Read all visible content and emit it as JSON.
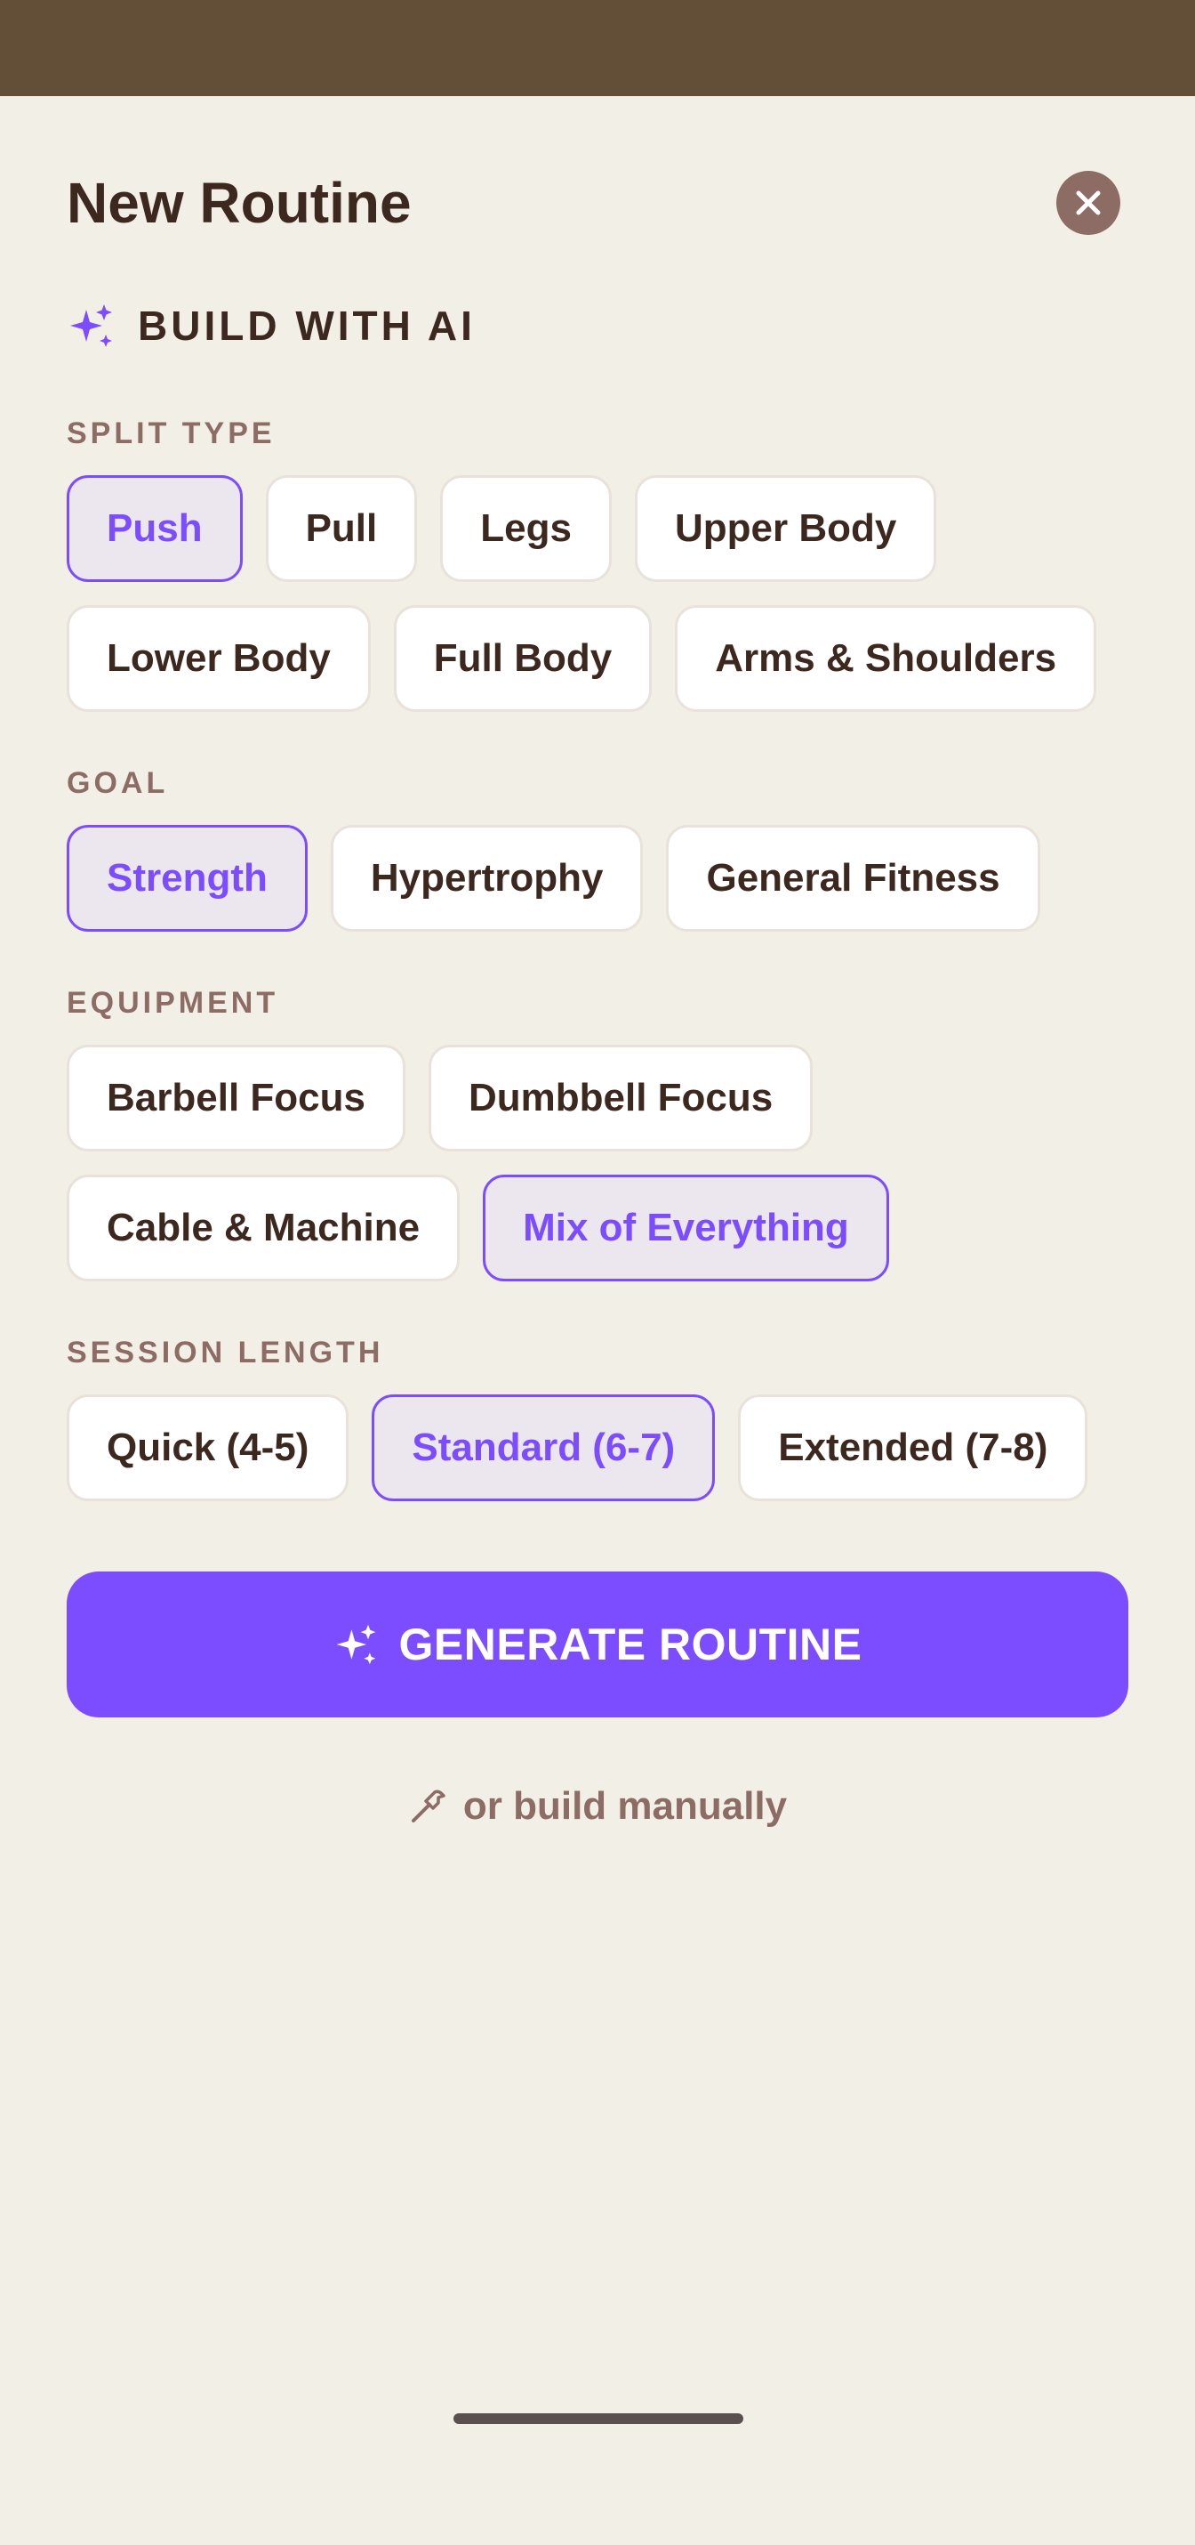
{
  "colors": {
    "accent": "#7c4dff",
    "accent_soft": "#ece6ee",
    "text_primary": "#3d2820",
    "text_muted": "#8c6c64",
    "background": "#f2efe6",
    "backdrop": "#634e37"
  },
  "sheet": {
    "title": "New Routine",
    "close_icon": "close-icon"
  },
  "ai_section": {
    "icon": "sparkles-icon",
    "label": "BUILD WITH AI"
  },
  "split_type": {
    "label": "SPLIT TYPE",
    "options": [
      "Push",
      "Pull",
      "Legs",
      "Upper Body",
      "Lower Body",
      "Full Body",
      "Arms & Shoulders"
    ],
    "selected": "Push"
  },
  "goal": {
    "label": "GOAL",
    "options": [
      "Strength",
      "Hypertrophy",
      "General Fitness"
    ],
    "selected": "Strength"
  },
  "equipment": {
    "label": "EQUIPMENT",
    "options": [
      "Barbell Focus",
      "Dumbbell Focus",
      "Cable & Machine",
      "Mix of Everything"
    ],
    "selected": "Mix of Everything"
  },
  "session_length": {
    "label": "SESSION LENGTH",
    "options": [
      "Quick (4-5)",
      "Standard (6-7)",
      "Extended (7-8)"
    ],
    "selected": "Standard (6-7)"
  },
  "generate_button": {
    "icon": "sparkles-icon",
    "label": "GENERATE ROUTINE"
  },
  "manual_link": {
    "icon": "hammer-icon",
    "label": "or build manually"
  }
}
